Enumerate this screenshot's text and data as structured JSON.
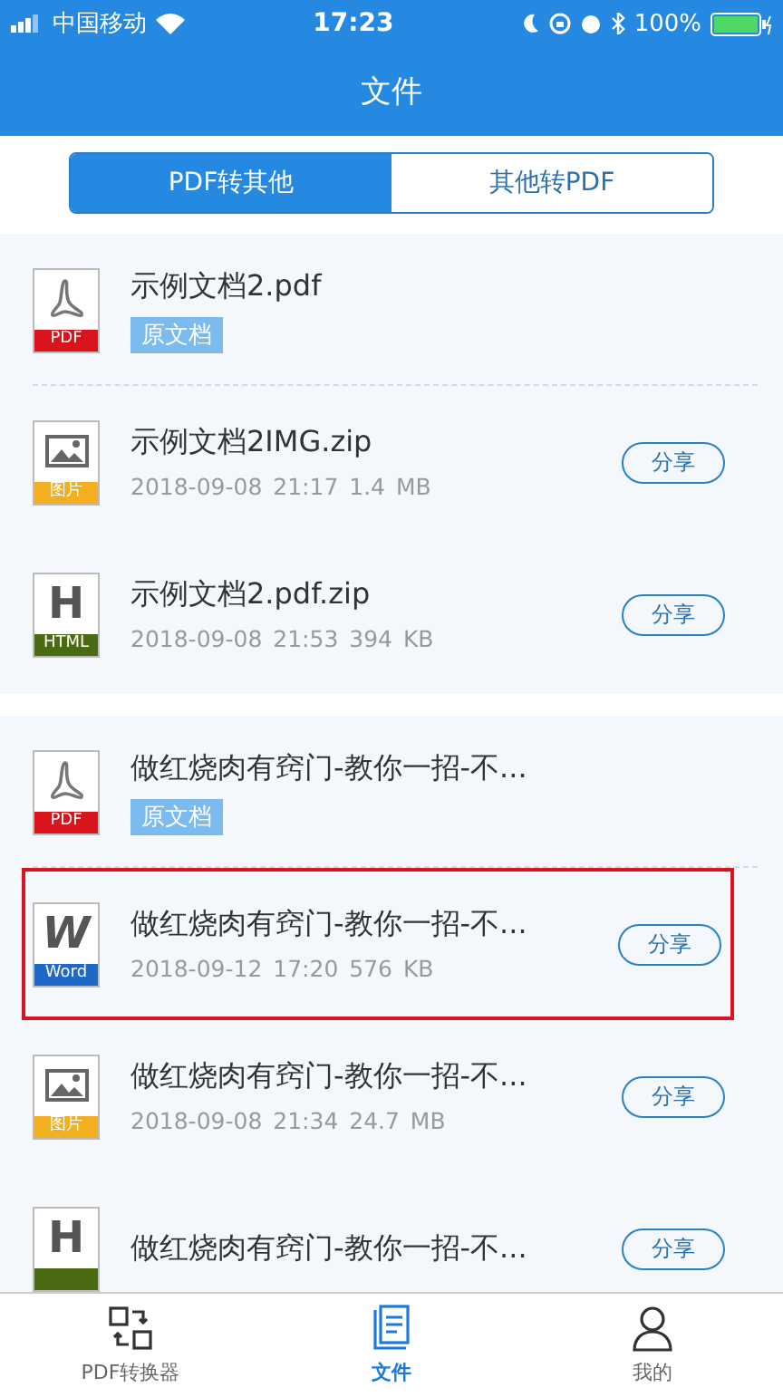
{
  "status_bar": {
    "carrier": "中国移动",
    "time": "17:23",
    "battery": "100%"
  },
  "header": {
    "title": "文件"
  },
  "segments": [
    {
      "label": "PDF转其他",
      "selected": true
    },
    {
      "label": "其他转PDF",
      "selected": false
    }
  ],
  "groups": [
    {
      "rows": [
        {
          "kind": "pdf",
          "badge": "PDF",
          "name": "示例文档2.pdf",
          "tag": "原文档",
          "highlighted": false
        },
        {
          "kind": "image",
          "badge": "图片",
          "name": "示例文档2IMG.zip",
          "date": "2018-09-08 21:17",
          "size": "1.4 MB",
          "share": "分享",
          "highlighted": false
        },
        {
          "kind": "html",
          "glyph": "H",
          "badge": "HTML",
          "name": "示例文档2.pdf.zip",
          "date": "2018-09-08 21:53",
          "size": "394 KB",
          "share": "分享",
          "highlighted": false
        }
      ]
    },
    {
      "rows": [
        {
          "kind": "pdf",
          "badge": "PDF",
          "name": "做红烧肉有窍门-教你一招-不...",
          "tag": "原文档",
          "highlighted": false
        },
        {
          "kind": "word",
          "glyph": "W",
          "badge": "Word",
          "name": "做红烧肉有窍门-教你一招-不...",
          "date": "2018-09-12 17:20",
          "size": "576 KB",
          "share": "分享",
          "highlighted": true
        },
        {
          "kind": "image",
          "badge": "图片",
          "name": "做红烧肉有窍门-教你一招-不...",
          "date": "2018-09-08 21:34",
          "size": "24.7 MB",
          "share": "分享",
          "highlighted": false
        },
        {
          "kind": "html",
          "glyph": "H",
          "name": "做红烧肉有窍门-教你一招-不...",
          "share": "分享",
          "highlighted": false
        }
      ]
    }
  ],
  "tab_bar": [
    {
      "label": "PDF转换器",
      "selected": false
    },
    {
      "label": "文件",
      "selected": true
    },
    {
      "label": "我的",
      "selected": false
    }
  ]
}
